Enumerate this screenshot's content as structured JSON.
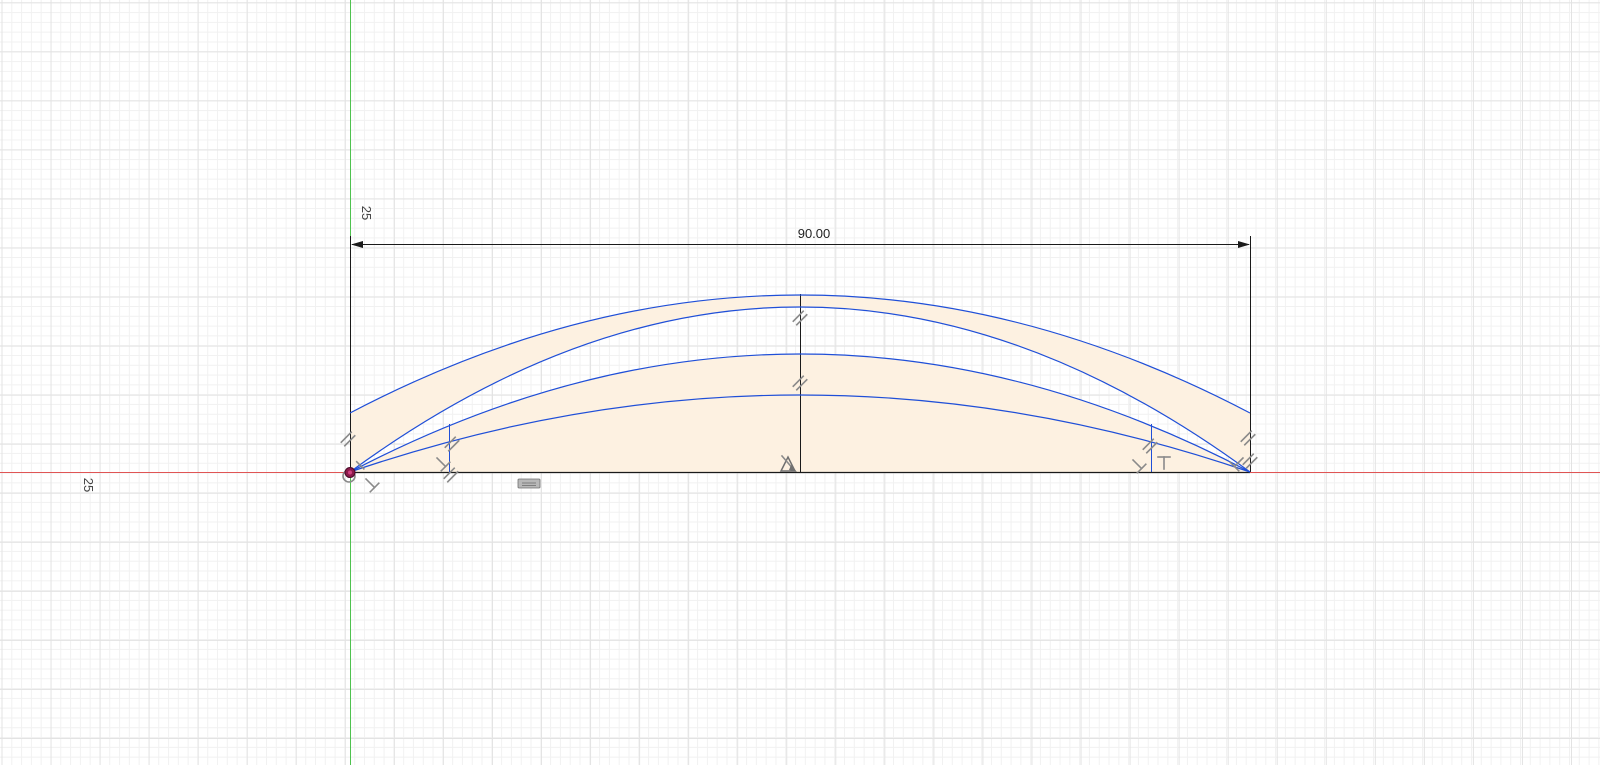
{
  "sketch": {
    "dimension_label": "90.00",
    "axis_label_vertical": "25",
    "axis_label_horizontal": "25"
  },
  "colors": {
    "sketch_line": "#1f4fd8",
    "profile_fill": "#fdf1e1",
    "x_axis": "#e05555",
    "y_axis": "#4fc24f",
    "dimension_line": "#1a1a1a",
    "origin_point": "#8b1a4a"
  },
  "icons": {
    "equal_constraint": "equal-constraint-icon",
    "perpendicular_constraint": "perpendicular-constraint-icon",
    "horizontal_constraint": "horizontal-constraint-icon",
    "coincident_constraint": "coincident-constraint-icon",
    "fix_constraint": "fix-constraint-icon",
    "midpoint_constraint": "midpoint-constraint-icon"
  }
}
